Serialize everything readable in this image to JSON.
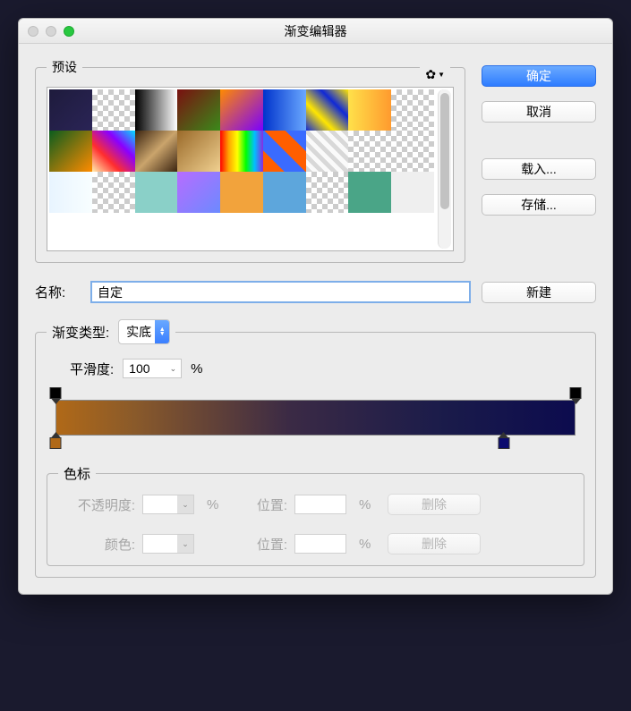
{
  "title": "渐变编辑器",
  "presets": {
    "legend": "预设",
    "swatches": [
      "linear-gradient(135deg,#1e1b3c,#2a2456)",
      "checker",
      "linear-gradient(90deg,#000,#fff)",
      "linear-gradient(135deg,#7a1010,#3a8a1a)",
      "linear-gradient(135deg,#ff8a00,#7a00ff)",
      "linear-gradient(90deg,#0033cc,#6aa8ff)",
      "linear-gradient(45deg,#1029d6,#ffe600,#1029d6,#ffe600)",
      "linear-gradient(90deg,#ffe14a,#ff9a2e)",
      "checker",
      "linear-gradient(135deg,#0a5c1e,#ff8c00)",
      "linear-gradient(45deg,#ffefae,#ff2e2e,#8a00ff,#00e0ff)",
      "linear-gradient(135deg,#3b2410,#caa46c,#3b2410)",
      "linear-gradient(135deg,#9a6a2a,#f0d090)",
      "linear-gradient(90deg,#ff0000,#ffa500,#ffff00,#00ff00,#00bfff,#8a2be2)",
      "linear-gradient(45deg,#ff5e00 0 25%,#3a6bff 0 50%,#ff5e00 0 75%,#3a6bff 0)",
      "repeating-linear-gradient(45deg,#d8d8d8 0 5px,#fafafa 5px 10px)",
      "checker",
      "checker",
      "linear-gradient(90deg,#e8f4ff,#f8feff)",
      "checker",
      "#8ad0c8",
      "linear-gradient(135deg,#b76cff,#6c8aff)",
      "#f2a33c",
      "#5da6dc",
      "checker",
      "#4aa587",
      ""
    ]
  },
  "buttons": {
    "ok": "确定",
    "cancel": "取消",
    "load": "载入...",
    "save": "存储...",
    "new": "新建",
    "delete": "删除"
  },
  "name": {
    "label": "名称:",
    "value": "自定"
  },
  "gradient": {
    "type_label": "渐变类型:",
    "type_value": "实底",
    "smooth_label": "平滑度:",
    "smooth_value": "100",
    "percent": "%",
    "stops": {
      "op_left": {
        "pos": 10,
        "bg": "#000"
      },
      "op_right": {
        "pos": 602,
        "bg": "#000"
      },
      "col_left": {
        "pos": 10,
        "bg": "#b06918"
      },
      "col_right": {
        "pos": 530,
        "bg": "#0c0b6e"
      }
    }
  },
  "stops_panel": {
    "legend": "色标",
    "opacity_label": "不透明度:",
    "position_label": "位置:",
    "color_label": "颜色:"
  }
}
